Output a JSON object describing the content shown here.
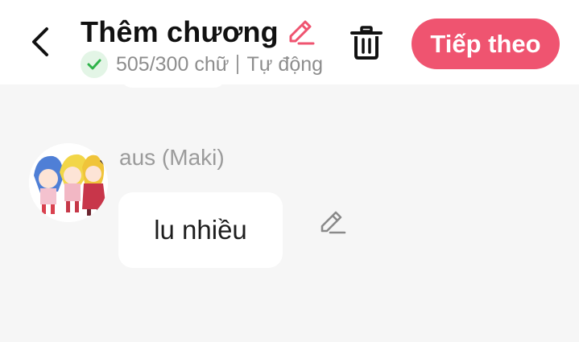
{
  "header": {
    "title": "Thêm chương",
    "word_count": "505/300 chữ",
    "status": "Tự động lưu",
    "next_label": "Tiếp theo",
    "icons": {
      "back": "back-arrow-icon",
      "edit_title": "pencil-icon",
      "check": "check-icon",
      "trash": "trash-icon"
    }
  },
  "message": {
    "character_name": "aus (Maki)",
    "text": "lu nhiều",
    "icons": {
      "edit": "pencil-icon",
      "avatar": "character-avatar"
    }
  },
  "colors": {
    "accent": "#ef5470",
    "success": "#2fb34a",
    "success_bg": "#e3f5e6",
    "muted_text": "#8d8d8d",
    "page_bg": "#f6f6f6"
  }
}
